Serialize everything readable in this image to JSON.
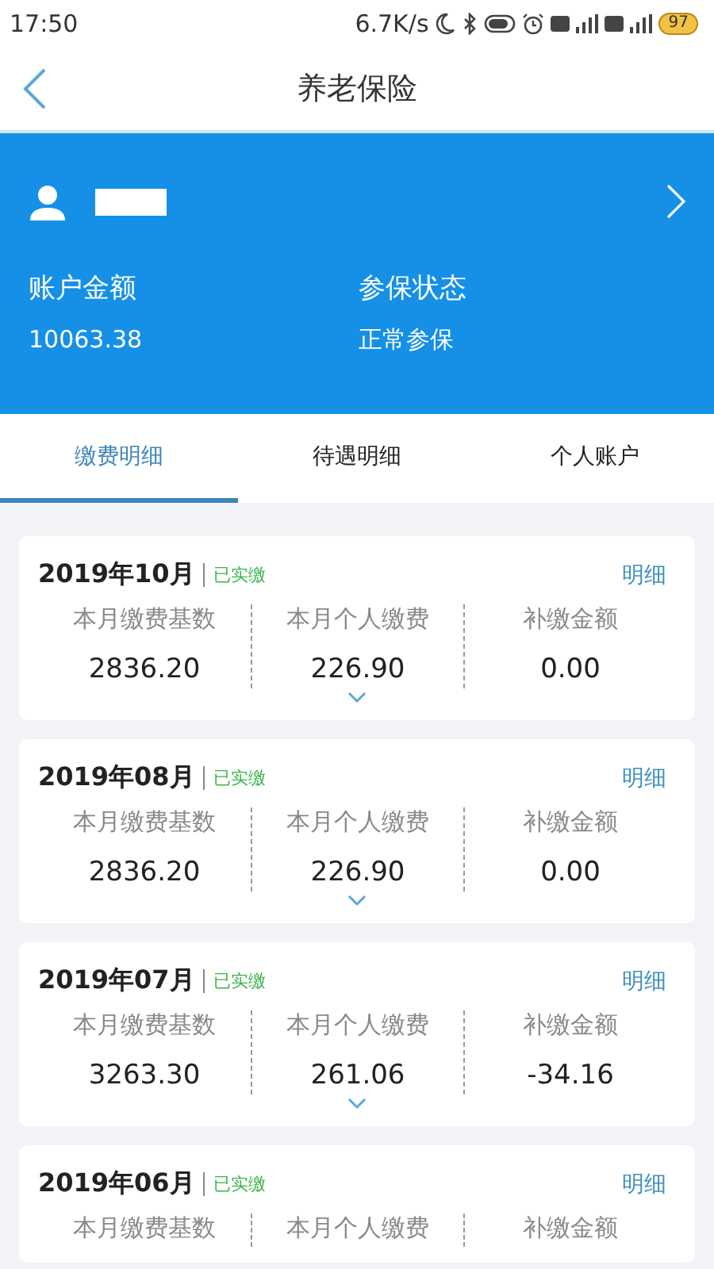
{
  "status_bar": {
    "time": "17:50",
    "speed": "6.7K/s",
    "battery": "97"
  },
  "nav": {
    "title": "养老保险"
  },
  "account": {
    "balance_label": "账户金额",
    "balance": "10063.38",
    "status_label": "参保状态",
    "status": "正常参保"
  },
  "tabs": [
    {
      "label": "缴费明细",
      "selected": true
    },
    {
      "label": "待遇明细",
      "selected": false
    },
    {
      "label": "个人账户",
      "selected": false
    }
  ],
  "records": [
    {
      "month": "2019年10月",
      "status": "已实缴",
      "detail": "明细",
      "fields": [
        {
          "label": "本月缴费基数",
          "value": "2836.20"
        },
        {
          "label": "本月个人缴费",
          "value": "226.90"
        },
        {
          "label": "补缴金额",
          "value": "0.00"
        }
      ]
    },
    {
      "month": "2019年08月",
      "status": "已实缴",
      "detail": "明细",
      "fields": [
        {
          "label": "本月缴费基数",
          "value": "2836.20"
        },
        {
          "label": "本月个人缴费",
          "value": "226.90"
        },
        {
          "label": "补缴金额",
          "value": "0.00"
        }
      ]
    },
    {
      "month": "2019年07月",
      "status": "已实缴",
      "detail": "明细",
      "fields": [
        {
          "label": "本月缴费基数",
          "value": "3263.30"
        },
        {
          "label": "本月个人缴费",
          "value": "261.06"
        },
        {
          "label": "补缴金额",
          "value": "-34.16"
        }
      ]
    },
    {
      "month": "2019年06月",
      "status": "已实缴",
      "detail": "明细",
      "fields": [
        {
          "label": "本月缴费基数"
        },
        {
          "label": "本月个人缴费"
        },
        {
          "label": "补缴金额"
        }
      ]
    }
  ]
}
